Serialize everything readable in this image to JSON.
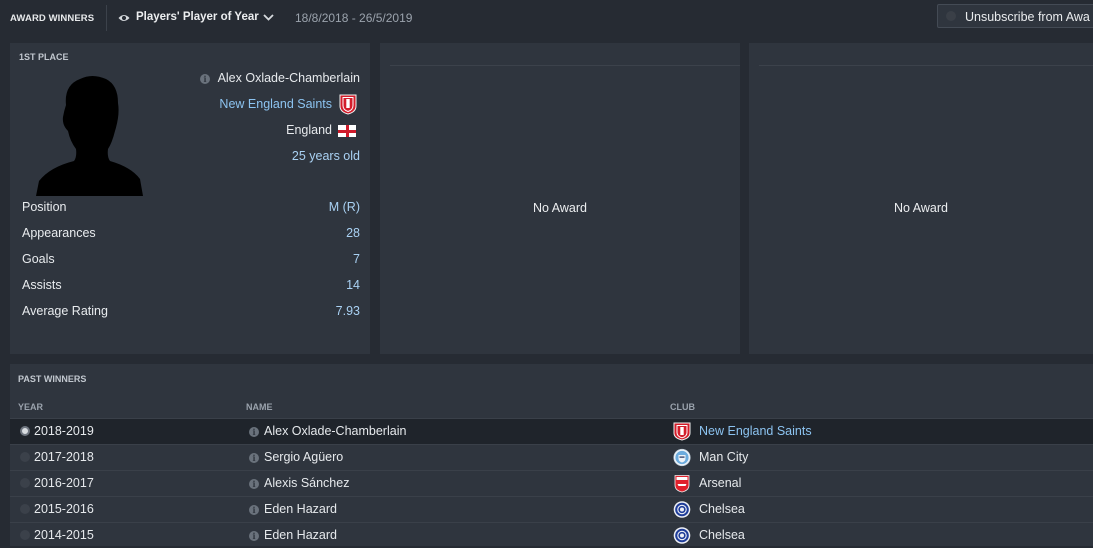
{
  "topbar": {
    "title": "AWARD WINNERS",
    "award_selector": "Players' Player of Year",
    "date_range": "18/8/2018 - 26/5/2019",
    "unsubscribe_label": "Unsubscribe from Awa"
  },
  "first_place": {
    "title": "1ST PLACE",
    "player_name": "Alex Oxlade-Chamberlain",
    "club": "New England Saints",
    "nationality": "England",
    "age": "25 years old",
    "stats": [
      {
        "label": "Position",
        "value": "M (R)"
      },
      {
        "label": "Appearances",
        "value": "28"
      },
      {
        "label": "Goals",
        "value": "7"
      },
      {
        "label": "Assists",
        "value": "14"
      },
      {
        "label": "Average Rating",
        "value": "7.93"
      }
    ]
  },
  "second_panel": {
    "text": "No Award"
  },
  "third_panel": {
    "text": "No Award"
  },
  "past_winners": {
    "title": "PAST WINNERS",
    "columns": {
      "year": "YEAR",
      "name": "NAME",
      "club": "CLUB"
    },
    "rows": [
      {
        "year": "2018-2019",
        "name": "Alex Oxlade-Chamberlain",
        "club": "New England Saints",
        "club_icon": "saints-crest-icon"
      },
      {
        "year": "2017-2018",
        "name": "Sergio Agüero",
        "club": "Man City",
        "club_icon": "man-city-crest-icon"
      },
      {
        "year": "2016-2017",
        "name": "Alexis Sánchez",
        "club": "Arsenal",
        "club_icon": "arsenal-crest-icon"
      },
      {
        "year": "2015-2016",
        "name": "Eden Hazard",
        "club": "Chelsea",
        "club_icon": "chelsea-crest-icon"
      },
      {
        "year": "2014-2015",
        "name": "Eden Hazard",
        "club": "Chelsea",
        "club_icon": "chelsea-crest-icon"
      }
    ]
  },
  "colors": {
    "background": "#262b33",
    "panel": "#2f353e",
    "link": "#8cc3f0",
    "value": "#a9d1f3",
    "selected_row": "#1f242b"
  }
}
